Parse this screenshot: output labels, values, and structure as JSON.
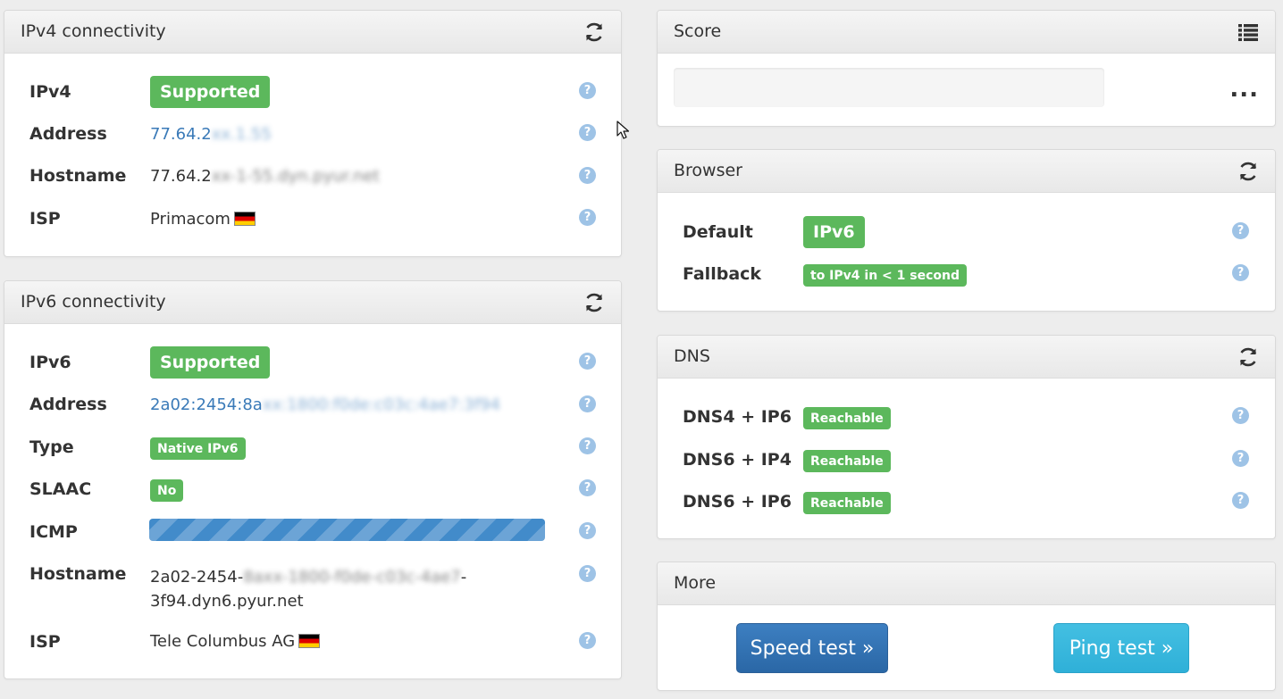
{
  "ipv4_panel": {
    "title": "IPv4 connectivity",
    "rows": [
      {
        "label": "IPv4",
        "value": "Supported"
      },
      {
        "label": "Address",
        "value_visible": "77.64.2",
        "value_blurred": "xx.1.55"
      },
      {
        "label": "Hostname",
        "value_visible": "77.64.2",
        "value_blurred": "xx-1-55.dyn.pyur.net"
      },
      {
        "label": "ISP",
        "value": "Primacom"
      }
    ]
  },
  "ipv6_panel": {
    "title": "IPv6 connectivity",
    "rows": [
      {
        "label": "IPv6",
        "value": "Supported"
      },
      {
        "label": "Address",
        "value_visible": "2a02:2454:8a",
        "value_blurred": "xx:1800:f0de:c03c:4ae7:3f94"
      },
      {
        "label": "Type",
        "value": "Native IPv6"
      },
      {
        "label": "SLAAC",
        "value": "No"
      },
      {
        "label": "ICMP"
      },
      {
        "label": "Hostname",
        "value_visible": "2a02-2454-",
        "value_blurred": "8axx-1800-f0de-c03c-4ae7",
        "value_line2": "-",
        "value_line3": "3f94.dyn6.pyur.net"
      },
      {
        "label": "ISP",
        "value": "Tele Columbus AG"
      }
    ]
  },
  "score_panel": {
    "title": "Score",
    "more": "..."
  },
  "browser_panel": {
    "title": "Browser",
    "rows": [
      {
        "label": "Default",
        "value": "IPv6"
      },
      {
        "label": "Fallback",
        "value": "to IPv4 in < 1 second"
      }
    ]
  },
  "dns_panel": {
    "title": "DNS",
    "rows": [
      {
        "label": "DNS4 + IP6",
        "value": "Reachable"
      },
      {
        "label": "DNS6 + IP4",
        "value": "Reachable"
      },
      {
        "label": "DNS6 + IP6",
        "value": "Reachable"
      }
    ]
  },
  "more_panel": {
    "title": "More",
    "speed_test": "Speed test »",
    "ping_test": "Ping test »"
  },
  "help_glyph": "?",
  "icons": {
    "refresh": "refresh-icon",
    "list": "list-icon",
    "help": "help-icon",
    "flag": "germany-flag-icon"
  },
  "colors": {
    "success": "#5cb85c",
    "primary": "#337ab7",
    "info": "#31b0d5",
    "help": "#9ec3e6"
  }
}
